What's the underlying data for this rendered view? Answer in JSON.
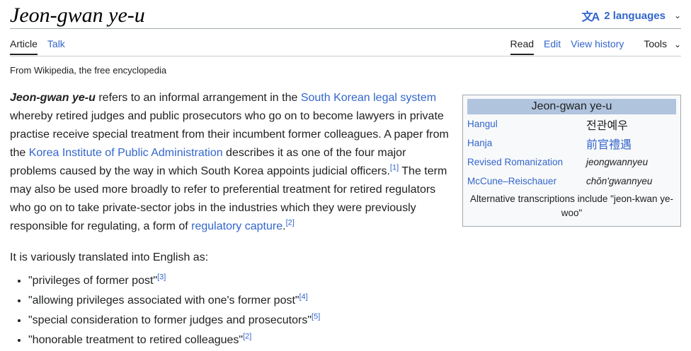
{
  "header": {
    "title": "Jeon-gwan ye-u",
    "languages_label": "2 languages"
  },
  "tabs": {
    "left": [
      {
        "label": "Article"
      },
      {
        "label": "Talk"
      }
    ],
    "right": [
      {
        "label": "Read"
      },
      {
        "label": "Edit"
      },
      {
        "label": "View history"
      }
    ],
    "tools_label": "Tools"
  },
  "tagline": "From Wikipedia, the free encyclopedia",
  "lead": {
    "term": "Jeon-gwan ye-u",
    "t1": " refers to an informal arrangement in the ",
    "link1": "South Korean legal system",
    "t2": " whereby retired judges and public prosecutors who go on to become lawyers in private practise receive special treatment from their incumbent former colleagues. A paper from the ",
    "link2": "Korea Institute of Public Administration",
    "t3": " describes it as one of the four major problems caused by the way in which South Korea appoints judicial officers.",
    "ref1": "[1]",
    "t4": " The term may also be used more broadly to refer to preferential treatment for retired regulators who go on to take private-sector jobs in the industries which they were previously responsible for regulating, a form of ",
    "link3": "regulatory capture",
    "t5": ".",
    "ref2": "[2]"
  },
  "translations": {
    "intro": "It is variously translated into English as:",
    "items": [
      {
        "text": "\"privileges of former post\"",
        "ref": "[3]"
      },
      {
        "text": "\"allowing privileges associated with one's former post\"",
        "ref": "[4]"
      },
      {
        "text": "\"special consideration to former judges and prosecutors\"",
        "ref": "[5]"
      },
      {
        "text": "\"honorable treatment to retired colleagues\"",
        "ref": "[2]"
      }
    ]
  },
  "infobox": {
    "title": "Jeon-gwan ye-u",
    "rows": [
      {
        "label": "Hangul",
        "value": "전관예우"
      },
      {
        "label": "Hanja",
        "value": "前官禮遇"
      },
      {
        "label": "Revised Romanization",
        "value": "jeongwannyeu"
      },
      {
        "label": "McCune–Reischauer",
        "value": "chŏn'gwannyeu"
      }
    ],
    "note": "Alternative transcriptions include \"jeon-kwan ye-woo\""
  },
  "colors": {
    "link": "#3366cc",
    "infobox_header": "#b0c4de"
  }
}
